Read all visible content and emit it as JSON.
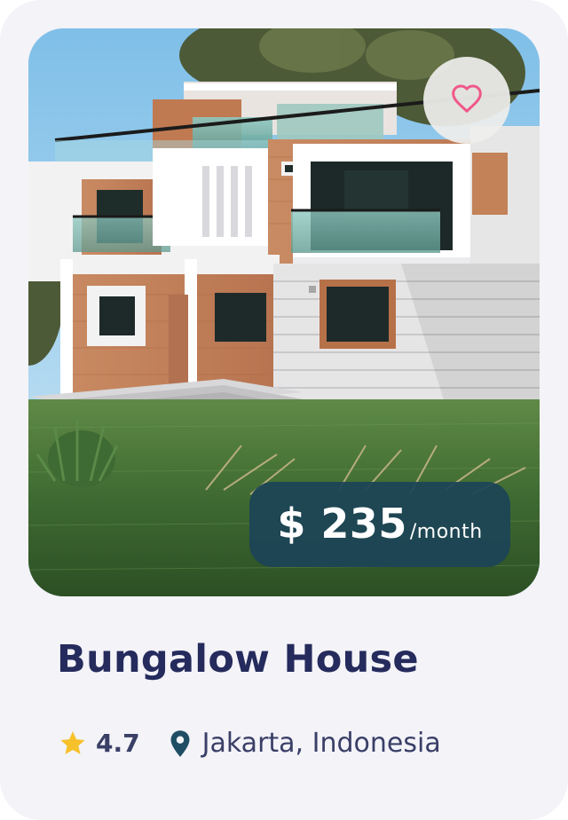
{
  "listing": {
    "title": "Bungalow House",
    "price_amount": "$ 235",
    "price_unit": "/month",
    "rating": "4.7",
    "location": "Jakarta, Indonesia",
    "image": "house-photo"
  },
  "icons": {
    "favorite": "heart-icon",
    "rating": "star-icon",
    "location": "map-pin-icon"
  },
  "colors": {
    "card_background": "#f3f3f8",
    "title": "#252b5c",
    "text": "#3a3f67",
    "price_badge": "#1c4456",
    "heart": "#f0578a",
    "star": "#f6c12a",
    "pin": "#1f4e64"
  }
}
